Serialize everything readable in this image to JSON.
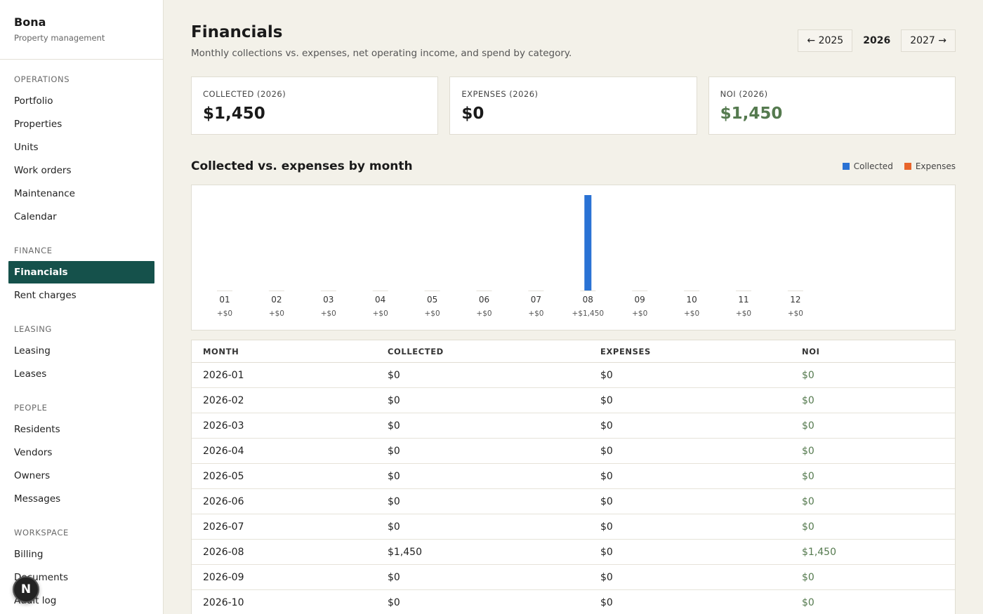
{
  "brand": {
    "name": "Bona",
    "subtitle": "Property management"
  },
  "sidebar": {
    "sections": [
      {
        "title": "OPERATIONS",
        "items": [
          "Portfolio",
          "Properties",
          "Units",
          "Work orders",
          "Maintenance",
          "Calendar"
        ]
      },
      {
        "title": "FINANCE",
        "items": [
          "Financials",
          "Rent charges"
        ]
      },
      {
        "title": "LEASING",
        "items": [
          "Leasing",
          "Leases"
        ]
      },
      {
        "title": "PEOPLE",
        "items": [
          "Residents",
          "Vendors",
          "Owners",
          "Messages"
        ]
      },
      {
        "title": "WORKSPACE",
        "items": [
          "Billing",
          "Documents",
          "Audit log"
        ]
      }
    ],
    "active": "Financials"
  },
  "fab": {
    "label": "N"
  },
  "page": {
    "title": "Financials",
    "subtitle": "Monthly collections vs. expenses, net operating income, and spend by category."
  },
  "year_nav": {
    "prev": "← 2025",
    "current": "2026",
    "next": "2027 →"
  },
  "cards": [
    {
      "label": "COLLECTED (2026)",
      "value": "$1,450",
      "tone": "default"
    },
    {
      "label": "EXPENSES (2026)",
      "value": "$0",
      "tone": "default"
    },
    {
      "label": "NOI (2026)",
      "value": "$1,450",
      "tone": "green"
    }
  ],
  "chart_section": {
    "title": "Collected vs. expenses by month"
  },
  "colors": {
    "collected": "#2a72d4",
    "expenses": "#e8652b",
    "noi": "#557a4f",
    "active_nav": "#15514b"
  },
  "chart_data": {
    "type": "bar",
    "categories": [
      "01",
      "02",
      "03",
      "04",
      "05",
      "06",
      "07",
      "08",
      "09",
      "10",
      "11",
      "12"
    ],
    "series": [
      {
        "name": "Collected",
        "values": [
          0,
          0,
          0,
          0,
          0,
          0,
          0,
          1450,
          0,
          0,
          0,
          0
        ]
      },
      {
        "name": "Expenses",
        "values": [
          0,
          0,
          0,
          0,
          0,
          0,
          0,
          0,
          0,
          0,
          0,
          0
        ]
      }
    ],
    "net_labels": [
      "+$0",
      "+$0",
      "+$0",
      "+$0",
      "+$0",
      "+$0",
      "+$0",
      "+$1,450",
      "+$0",
      "+$0",
      "+$0",
      "+$0"
    ],
    "legend": [
      "Collected",
      "Expenses"
    ],
    "legend_position": "top-right",
    "ylim": [
      0,
      1450
    ],
    "grid": false
  },
  "table": {
    "headers": [
      "MONTH",
      "COLLECTED",
      "EXPENSES",
      "NOI"
    ],
    "rows": [
      [
        "2026-01",
        "$0",
        "$0",
        "$0"
      ],
      [
        "2026-02",
        "$0",
        "$0",
        "$0"
      ],
      [
        "2026-03",
        "$0",
        "$0",
        "$0"
      ],
      [
        "2026-04",
        "$0",
        "$0",
        "$0"
      ],
      [
        "2026-05",
        "$0",
        "$0",
        "$0"
      ],
      [
        "2026-06",
        "$0",
        "$0",
        "$0"
      ],
      [
        "2026-07",
        "$0",
        "$0",
        "$0"
      ],
      [
        "2026-08",
        "$1,450",
        "$0",
        "$1,450"
      ],
      [
        "2026-09",
        "$0",
        "$0",
        "$0"
      ],
      [
        "2026-10",
        "$0",
        "$0",
        "$0"
      ]
    ]
  }
}
